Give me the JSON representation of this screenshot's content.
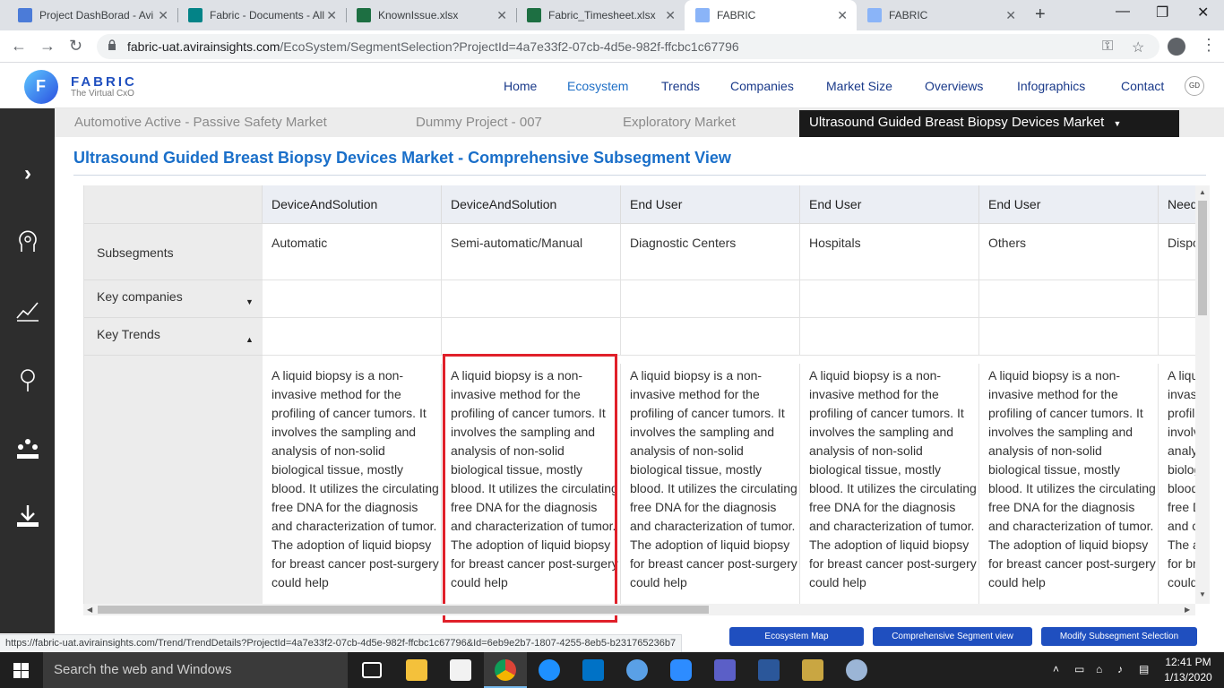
{
  "browser": {
    "tabs": [
      {
        "title": "Project DashBorad - Avi",
        "icon": "doc-icon",
        "color": "#4b7bd8"
      },
      {
        "title": "Fabric - Documents - All",
        "icon": "sharepoint-icon",
        "color": "#038387"
      },
      {
        "title": "KnownIssue.xlsx",
        "icon": "excel-icon",
        "color": "#1d6f42"
      },
      {
        "title": "Fabric_Timesheet.xlsx",
        "icon": "excel-icon",
        "color": "#1d6f42"
      },
      {
        "title": "FABRIC",
        "icon": "page-icon",
        "color": "#8ab4f8",
        "active": true
      },
      {
        "title": "FABRIC",
        "icon": "page-icon",
        "color": "#8ab4f8"
      }
    ],
    "url_host": "fabric-uat.avirainsights.com",
    "url_path": "/EcoSystem/SegmentSelection?ProjectId=4a7e33f2-07cb-4d5e-982f-ffcbc1c67796"
  },
  "site": {
    "brand": "FABRIC",
    "tagline": "The Virtual CxO",
    "avatar_initials": "GD",
    "nav": [
      "Home",
      "Ecosystem",
      "Trends",
      "Companies",
      "Market Size",
      "Overviews",
      "Infographics",
      "Contact"
    ],
    "active_nav": "Ecosystem"
  },
  "projects": {
    "items": [
      "Automotive Active - Passive Safety Market",
      "Dummy Project - 007",
      "Exploratory Market"
    ],
    "active": "Ultrasound Guided Breast Biopsy Devices Market"
  },
  "page": {
    "title": "Ultrasound Guided Breast Biopsy Devices Market - Comprehensive Subsegment View"
  },
  "table": {
    "row_labels": {
      "subsegments": "Subsegments",
      "key_companies": "Key companies",
      "key_trends": "Key Trends"
    },
    "columns": [
      {
        "segment": "DeviceAndSolution",
        "subsegment": "Automatic"
      },
      {
        "segment": "DeviceAndSolution",
        "subsegment": "Semi-automatic/Manual"
      },
      {
        "segment": "End User",
        "subsegment": "Diagnostic Centers"
      },
      {
        "segment": "End User",
        "subsegment": "Hospitals"
      },
      {
        "segment": "End User",
        "subsegment": "Others"
      },
      {
        "segment": "Need",
        "subsegment": "Disposable"
      }
    ],
    "trend_text": "A liquid biopsy is a non-invasive method for the profiling of cancer tumors. It involves the sampling and analysis of non-solid biological tissue, mostly blood. It utilizes the circulating free DNA for the diagnosis and characterization of tumor. The adoption of liquid biopsy for breast cancer post-surgery could help"
  },
  "status_url": "https://fabric-uat.avirainsights.com/Trend/TrendDetails?ProjectId=4a7e33f2-07cb-4d5e-982f-ffcbc1c67796&Id=6eb9e2b7-1807-4255-8eb5-b231765236b7",
  "buttons": {
    "ecosystem_map": "Ecosystem Map",
    "comprehensive": "Comprehensive Segment view",
    "modify": "Modify Subsegment Selection"
  },
  "taskbar": {
    "search_placeholder": "Search the web and Windows",
    "time": "12:41 PM",
    "date": "1/13/2020"
  }
}
